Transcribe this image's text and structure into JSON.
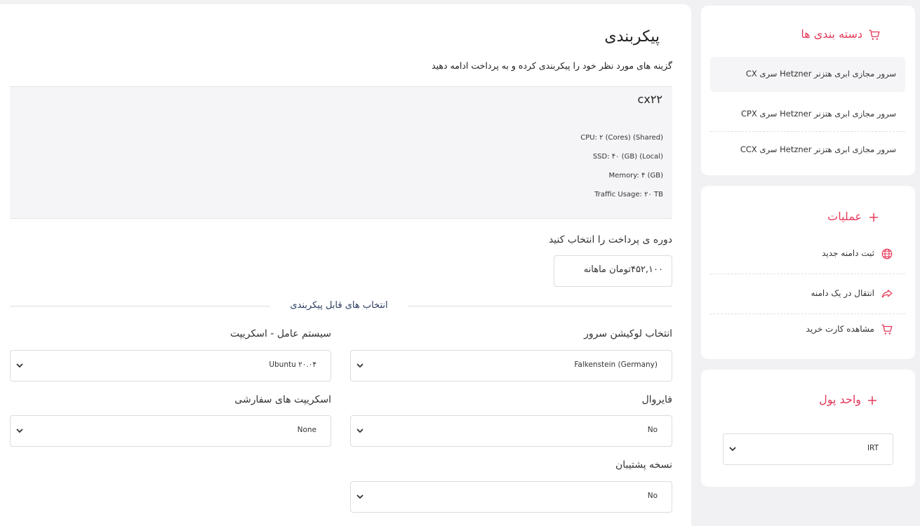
{
  "main": {
    "title": "پیکربندی",
    "subtitle": "گزینه های مورد نظر خود را پیکربندی کرده و به پرداخت ادامه دهید",
    "product": {
      "name": "cx۲۲",
      "specs": [
        "CPU: ۲ (Cores) (Shared)",
        "SSD: ۴۰ (GB) (Local)",
        "Memory: ۴ (GB)",
        "Traffic Usage: ۲۰ TB"
      ]
    },
    "billing": {
      "label": "دوره ی پرداخت را انتخاب کنید",
      "value": "۴۵۲,۱۰۰تومان ماهانه"
    },
    "options_divider": "انتخاب های قابل پیکربندی",
    "fields": {
      "location": {
        "label": "انتخاب لوکیشن سرور",
        "value": "Falkenstein (Germany)"
      },
      "os": {
        "label": "سیستم عامل - اسکریپت",
        "value": "Ubuntu ۲۰.۰۴"
      },
      "firewall": {
        "label": "فایروال",
        "value": "No"
      },
      "scripts": {
        "label": "اسکریپت های سفارشی",
        "value": "None"
      },
      "backup": {
        "label": "نسخه پشتیبان",
        "value": "No"
      }
    }
  },
  "sidebar": {
    "categories": {
      "title": "دسته بندی ها",
      "items": [
        "سرور مجازی ابری هتزنر Hetzner سری CX",
        "سرور مجازی ابری هتزنر Hetzner سری CPX",
        "سرور مجازی ابری هتزنر Hetzner سری CCX"
      ]
    },
    "actions": {
      "title": "عملیات",
      "items": [
        {
          "label": "ثبت دامنه جدید",
          "icon": "globe-icon"
        },
        {
          "label": "انتقال در یک دامنه",
          "icon": "share-arrow-icon"
        },
        {
          "label": "مشاهده کارت خرید",
          "icon": "cart-icon"
        }
      ]
    },
    "currency": {
      "title": "واحد پول",
      "value": "IRT"
    }
  },
  "colors": {
    "accent": "#e53a5b",
    "card": "#ffffff",
    "background": "#f1f1f4"
  }
}
